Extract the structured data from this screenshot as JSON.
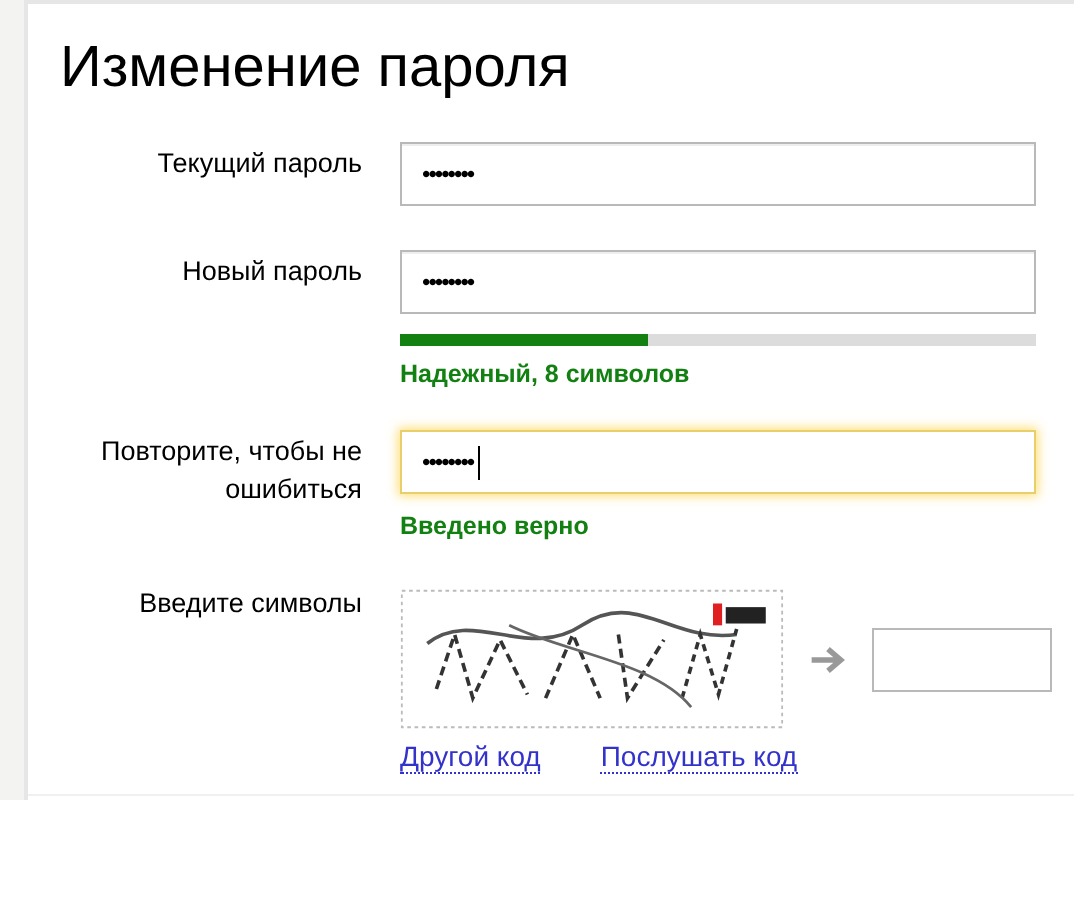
{
  "title": "Изменение пароля",
  "fields": [
    {
      "label": "Текущий пароль",
      "value": "••••••••",
      "focused": false
    },
    {
      "label": "Новый пароль",
      "value": "••••••••",
      "focused": false,
      "strength": {
        "level": 0.39,
        "text": "Надежный, 8 символов"
      }
    },
    {
      "label": "Повторите, чтобы не ошибиться",
      "value": "••••••••",
      "focused": true,
      "hint": "Введено верно"
    }
  ],
  "captcha": {
    "label": "Введите символы",
    "image": {
      "kind": "picture"
    },
    "links": [
      "Другой код",
      "Послушать код"
    ]
  }
}
